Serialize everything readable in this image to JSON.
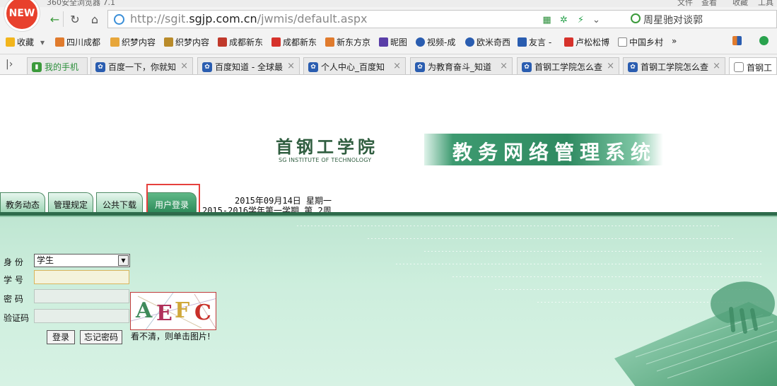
{
  "browser": {
    "window_title": "360安全浏览器 7.1",
    "title_right": [
      "文件",
      "查看",
      "收藏",
      "工具"
    ],
    "logo_badge": "NEW",
    "url_prefix": "http://sgit.",
    "url_domain": "sgjp.com.cn",
    "url_path": "/jwmis/default.aspx",
    "search_text": "周星驰对谈郭"
  },
  "bookmarks": {
    "items": [
      {
        "label": "收藏",
        "color": "#f2b51c"
      },
      {
        "label": "四川成都",
        "color": "#e07b2d"
      },
      {
        "label": "织梦内容",
        "color": "#e7a63a"
      },
      {
        "label": "织梦内容",
        "color": "#b98b2a"
      },
      {
        "label": "成都新东",
        "color": "#c0392b"
      },
      {
        "label": "成都新东",
        "color": "#d6322b"
      },
      {
        "label": "新东方京",
        "color": "#e07b2d"
      },
      {
        "label": "昵图",
        "color": "#5a3ea8"
      },
      {
        "label": "视频-成",
        "color": "#2a5db0"
      },
      {
        "label": "欧米奇西",
        "color": "#2a5db0"
      },
      {
        "label": "友言 -",
        "color": "#2a5db0"
      },
      {
        "label": "卢松松博",
        "color": "#d6322b"
      },
      {
        "label": "中国乡村",
        "color": "#888888"
      }
    ],
    "more": "»"
  },
  "tabs": {
    "items": [
      {
        "label": "我的手机",
        "active": false
      },
      {
        "label": "百度一下，你就知",
        "active": false
      },
      {
        "label": "百度知道 - 全球最",
        "active": false
      },
      {
        "label": "个人中心_百度知",
        "active": false
      },
      {
        "label": "为教育奋斗_知道",
        "active": false
      },
      {
        "label": "首钢工学院怎么查",
        "active": false
      },
      {
        "label": "首钢工学院怎么查",
        "active": false
      },
      {
        "label": "首钢工",
        "active": true
      }
    ]
  },
  "site": {
    "school_name": "首钢工学院",
    "school_name_en": "SG INSTITUTE OF TECHNOLOGY",
    "system_title": "教务网络管理系统",
    "menu": [
      "教务动态",
      "管理规定",
      "公共下载",
      "用户登录"
    ],
    "date_line1": "2015年09月14日 星期一",
    "date_line2": "2015-2016学年第一学期 第 2周"
  },
  "login": {
    "identity_label": "身  份",
    "identity_value": "学生",
    "student_no_label": "学  号",
    "password_label": "密  码",
    "captcha_label": "验证码",
    "captcha_letters": [
      "A",
      "E",
      "F",
      "C"
    ],
    "login_button": "登录",
    "forgot_button": "忘记密码",
    "captcha_hint": "看不清，则单击图片!"
  }
}
